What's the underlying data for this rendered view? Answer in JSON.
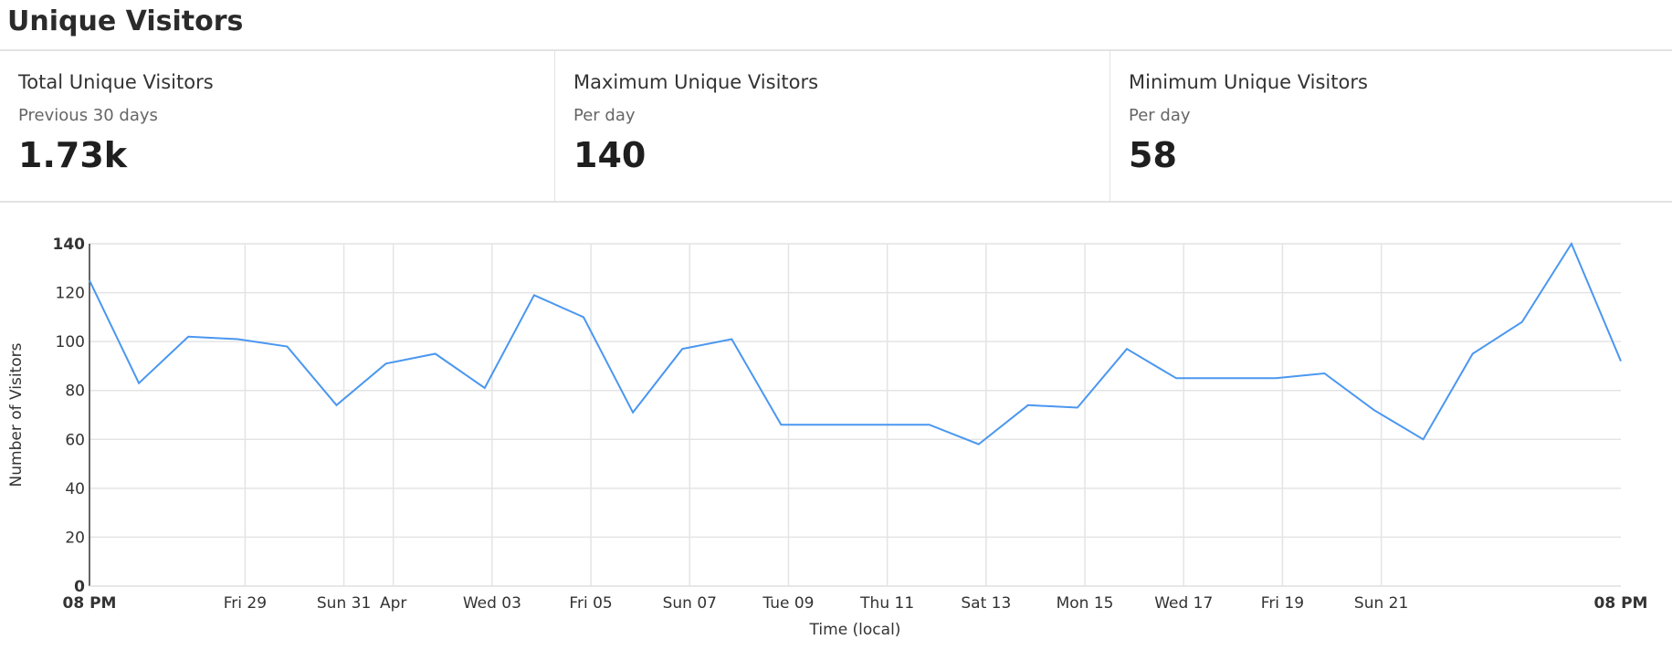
{
  "header": {
    "title": "Unique Visitors"
  },
  "stats": [
    {
      "label": "Total Unique Visitors",
      "sub": "Previous 30 days",
      "value": "1.73k"
    },
    {
      "label": "Maximum Unique Visitors",
      "sub": "Per day",
      "value": "140"
    },
    {
      "label": "Minimum Unique Visitors",
      "sub": "Per day",
      "value": "58"
    }
  ],
  "chart_data": {
    "type": "line",
    "xlabel": "Time (local)",
    "ylabel": "Number of Visitors",
    "ylim": [
      0,
      140
    ],
    "yticks": [
      0,
      20,
      40,
      60,
      80,
      100,
      120,
      140
    ],
    "grid": true,
    "line_color": "#4a97f0",
    "x_tick_labels": [
      {
        "label": "08 PM",
        "bold": true
      },
      {
        "label": "Fri 29"
      },
      {
        "label": "Sun 31"
      },
      {
        "label": "Apr"
      },
      {
        "label": "Wed 03"
      },
      {
        "label": "Fri 05"
      },
      {
        "label": "Sun 07"
      },
      {
        "label": "Tue 09"
      },
      {
        "label": "Thu 11"
      },
      {
        "label": "Sat 13"
      },
      {
        "label": "Mon 15"
      },
      {
        "label": "Wed 17"
      },
      {
        "label": "Fri 19"
      },
      {
        "label": "Sun 21"
      },
      {
        "label": "08 PM",
        "bold": true
      }
    ],
    "values": [
      125,
      83,
      102,
      101,
      98,
      74,
      91,
      95,
      81,
      119,
      110,
      71,
      97,
      101,
      66,
      66,
      66,
      66,
      58,
      74,
      73,
      97,
      85,
      85,
      85,
      87,
      72,
      60,
      95,
      108,
      140,
      92
    ]
  }
}
